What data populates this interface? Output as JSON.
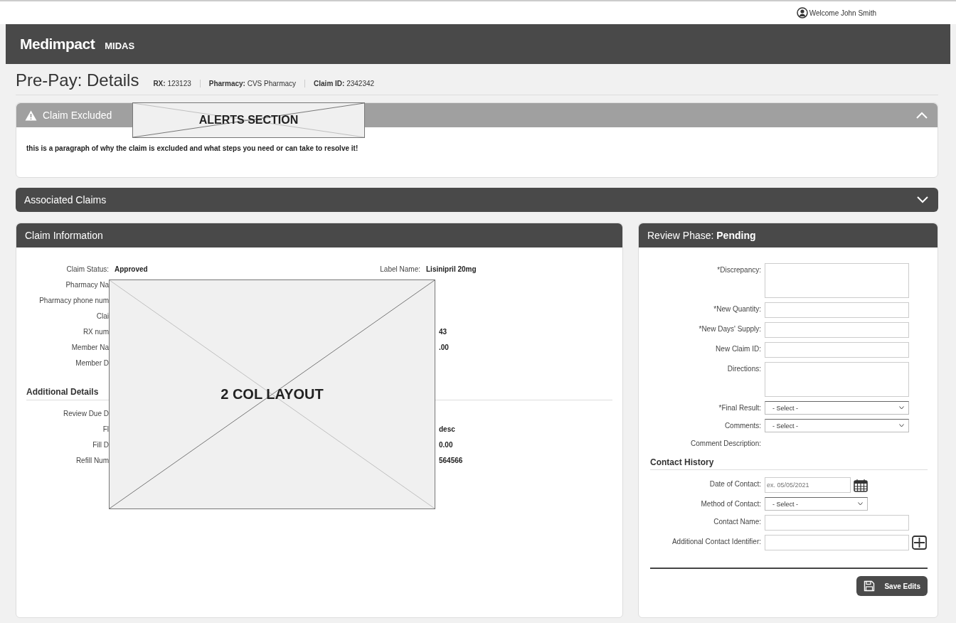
{
  "topbar": {
    "welcome": "Welcome John Smith"
  },
  "brand": {
    "logo": "Medimpact",
    "app": "MIDAS"
  },
  "page": {
    "title": "Pre-Pay: Details",
    "meta": [
      "**RX:** 123123",
      "**Pharmacy:** CVS Pharmacy",
      "**Claim ID:** 2342342"
    ]
  },
  "alert": {
    "title": "Claim Excluded",
    "expanded": true,
    "text": "this is a paragraph of why the claim is excluded and what steps you need or can take to resolve it!",
    "annotation": "ALERTS SECTION"
  },
  "associated_claims": {
    "title": "Associated Claims",
    "expanded": false
  },
  "claim_information": {
    "title": "Claim Information",
    "annotation": "2 COL LAYOUT",
    "rows": [
      {
        "label": "Claim Status:",
        "value": "Approved",
        "right_label": "Label Name:",
        "right_value": "Lisinipril 20mg"
      },
      {
        "label": "Pharmacy Na"
      },
      {
        "label": "Pharmacy phone num"
      },
      {
        "label": "Clai"
      },
      {
        "label": "RX num",
        "right_value": "43"
      },
      {
        "label": "Member Na",
        "right_value": ".00"
      },
      {
        "label": "Member D"
      }
    ],
    "additional_title": "Additional Details",
    "additional_rows": [
      {
        "label": "Review Due D"
      },
      {
        "label": "Fl",
        "right_value": "desc"
      },
      {
        "label": "Fill D",
        "right_value": "0.00"
      },
      {
        "label": "Refill Num",
        "right_value": "564566"
      }
    ]
  },
  "review": {
    "title": "Review Phase: **Pending**",
    "fields": [
      {
        "kind": "textarea",
        "label": "*Discrepancy:"
      },
      {
        "kind": "input",
        "label": "*New Quantity:"
      },
      {
        "kind": "input",
        "label": "*New Days' Supply:"
      },
      {
        "kind": "input",
        "label": "New Claim ID:"
      },
      {
        "kind": "textarea",
        "label": "Directions:"
      },
      {
        "kind": "select",
        "label": "*Final Result:",
        "value": "- Select -"
      },
      {
        "kind": "select",
        "label": "Comments:",
        "value": "- Select -"
      },
      {
        "kind": "text",
        "label": "Comment Description:"
      }
    ],
    "contact_title": "Contact History",
    "contact_fields": [
      {
        "kind": "date",
        "label": "Date of Contact:",
        "placeholder": "ex. 05/05/2021"
      },
      {
        "kind": "select",
        "label": "Method of Contact:",
        "value": "- Select -"
      },
      {
        "kind": "input",
        "label": "Contact Name:"
      },
      {
        "kind": "add",
        "label": "Additional Contact Identifier:"
      }
    ],
    "save_button": "Save Edits"
  }
}
